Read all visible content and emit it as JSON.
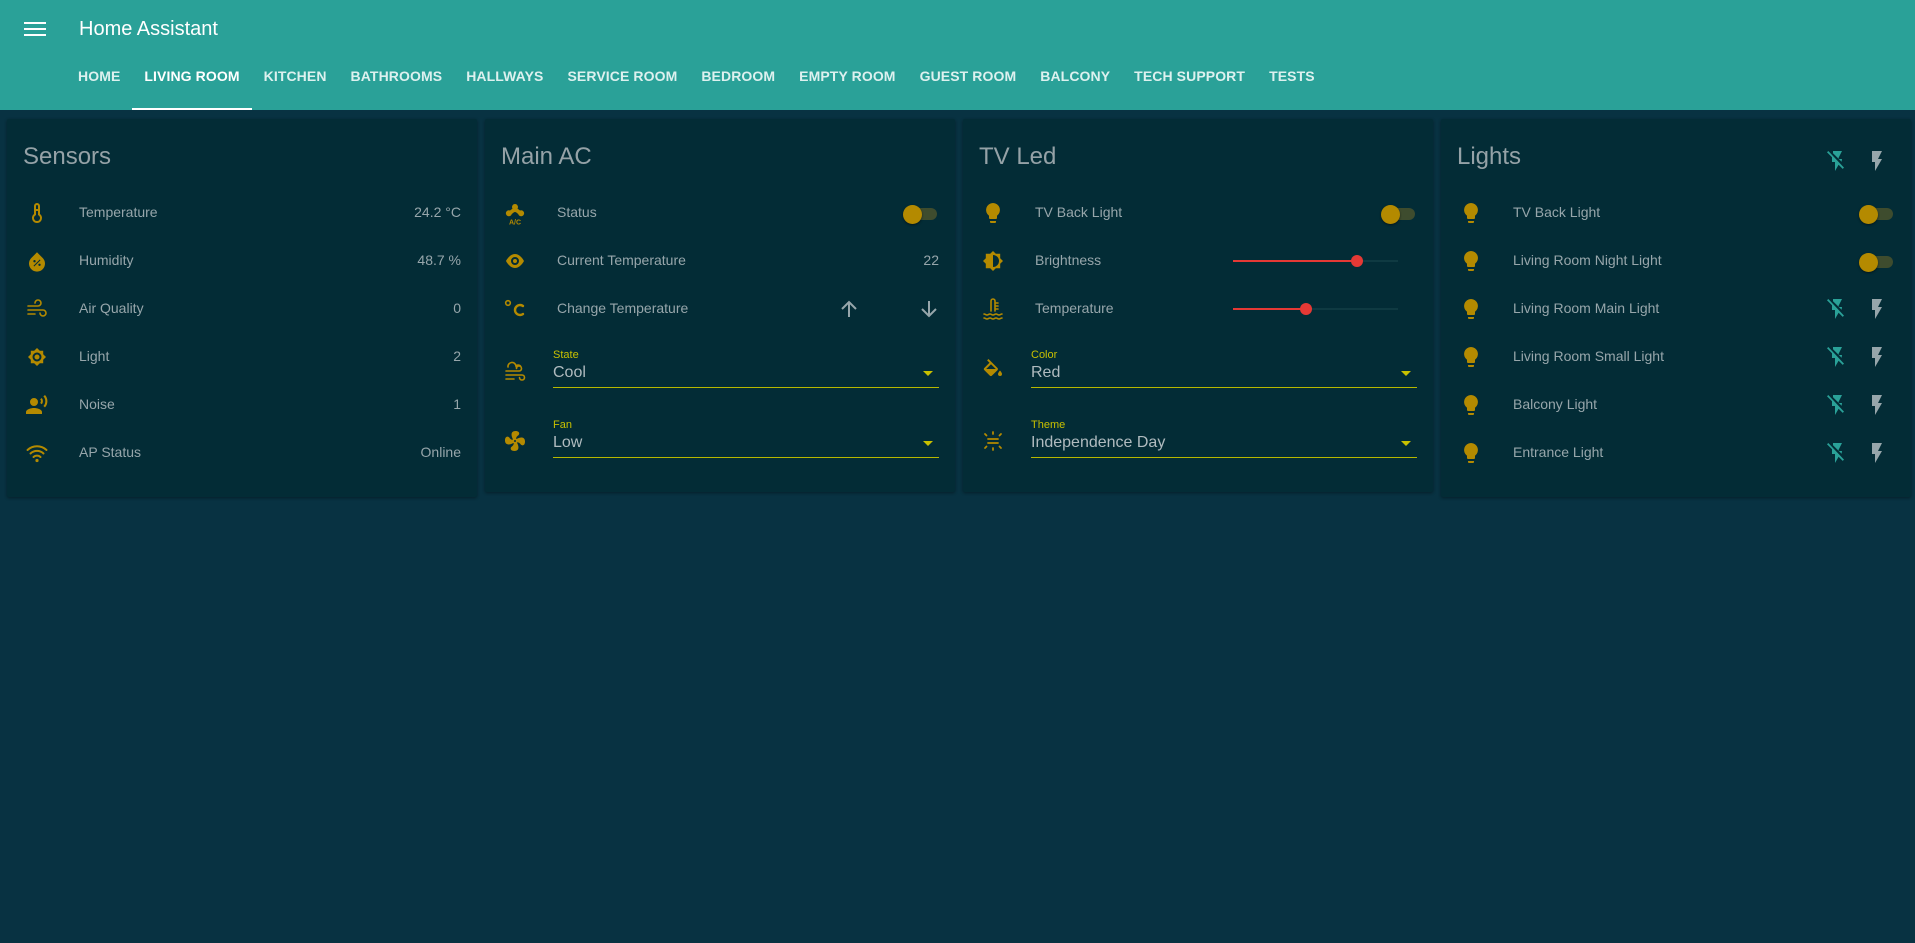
{
  "app": {
    "title": "Home Assistant"
  },
  "tabs": [
    {
      "label": "HOME"
    },
    {
      "label": "LIVING ROOM"
    },
    {
      "label": "KITCHEN"
    },
    {
      "label": "BATHROOMS"
    },
    {
      "label": "HALLWAYS"
    },
    {
      "label": "SERVICE ROOM"
    },
    {
      "label": "BEDROOM"
    },
    {
      "label": "EMPTY ROOM"
    },
    {
      "label": "GUEST ROOM"
    },
    {
      "label": "BALCONY"
    },
    {
      "label": "TECH SUPPORT"
    },
    {
      "label": "TESTS"
    }
  ],
  "active_tab": "LIVING ROOM",
  "colors": {
    "header": "#2aa198",
    "background": "#083242",
    "card": "#032c36",
    "icon": "#b48a00",
    "accent": "#c8c000",
    "slider": "#e53935",
    "lightning": "#2aa198"
  },
  "sensors": {
    "title": "Sensors",
    "rows": [
      {
        "icon": "thermometer-icon",
        "label": "Temperature",
        "value": "24.2 °C"
      },
      {
        "icon": "water-percent-icon",
        "label": "Humidity",
        "value": "48.7 %"
      },
      {
        "icon": "weather-windy-icon",
        "label": "Air Quality",
        "value": "0"
      },
      {
        "icon": "brightness-icon",
        "label": "Light",
        "value": "2"
      },
      {
        "icon": "account-voice-icon",
        "label": "Noise",
        "value": "1"
      },
      {
        "icon": "wifi-icon",
        "label": "AP Status",
        "value": "Online"
      }
    ]
  },
  "main_ac": {
    "title": "Main AC",
    "status": {
      "icon": "air-conditioner-icon",
      "label": "Status",
      "on": false
    },
    "current_temp": {
      "icon": "eye-icon",
      "label": "Current Temperature",
      "value": "22"
    },
    "change_temp": {
      "icon": "temperature-celsius-icon",
      "label": "Change Temperature"
    },
    "state": {
      "icon": "weather-windy-icon",
      "label": "State",
      "value": "Cool"
    },
    "fan": {
      "icon": "fan-icon",
      "label": "Fan",
      "value": "Low"
    }
  },
  "tv_led": {
    "title": "TV Led",
    "back_light": {
      "icon": "lightbulb-icon",
      "label": "TV Back Light",
      "on": false
    },
    "brightness": {
      "icon": "brightness-auto-icon",
      "label": "Brightness",
      "level": 0.75
    },
    "temperature": {
      "icon": "coolant-temperature-icon",
      "label": "Temperature",
      "level": 0.44
    },
    "color": {
      "icon": "format-color-fill-icon",
      "label": "Color",
      "value": "Red"
    },
    "theme": {
      "icon": "theme-light-dark-icon",
      "label": "Theme",
      "value": "Independence Day"
    }
  },
  "lights": {
    "title": "Lights",
    "rows": [
      {
        "label": "TV Back Light",
        "control": "toggle",
        "on": false
      },
      {
        "label": "Living Room Night Light",
        "control": "toggle",
        "on": false
      },
      {
        "label": "Living Room Main Light",
        "control": "buttons"
      },
      {
        "label": "Living Room Small Light",
        "control": "buttons"
      },
      {
        "label": "Balcony Light",
        "control": "buttons"
      },
      {
        "label": "Entrance Light",
        "control": "buttons"
      }
    ]
  }
}
